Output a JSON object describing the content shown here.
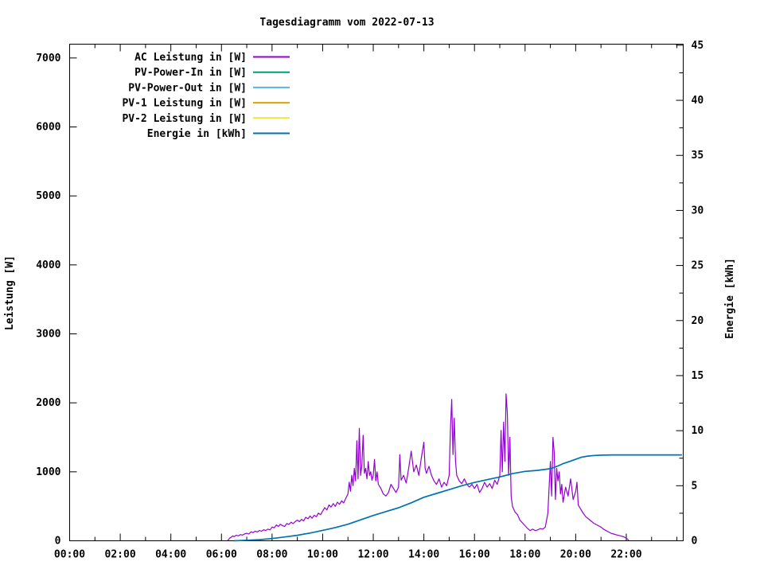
{
  "chart_data": {
    "type": "line",
    "title": "Tagesdiagramm vom 2022-07-13",
    "background": "#ffffff",
    "axis_color": "#000000",
    "grid": false,
    "legend_position": "top-left-inside",
    "x_axis": {
      "range_hours": [
        0,
        24.25
      ],
      "minor_step_hours": 1,
      "major_ticks": [
        {
          "h": 0,
          "label": "00:00"
        },
        {
          "h": 2,
          "label": "02:00"
        },
        {
          "h": 4,
          "label": "04:00"
        },
        {
          "h": 6,
          "label": "06:00"
        },
        {
          "h": 8,
          "label": "08:00"
        },
        {
          "h": 10,
          "label": "10:00"
        },
        {
          "h": 12,
          "label": "12:00"
        },
        {
          "h": 14,
          "label": "14:00"
        },
        {
          "h": 16,
          "label": "16:00"
        },
        {
          "h": 18,
          "label": "18:00"
        },
        {
          "h": 20,
          "label": "20:00"
        },
        {
          "h": 22,
          "label": "22:00"
        }
      ]
    },
    "left_axis": {
      "label": "Leistung [W]",
      "range": [
        0,
        7200
      ],
      "ticks": [
        {
          "v": 0,
          "label": "0"
        },
        {
          "v": 1000,
          "label": "1000"
        },
        {
          "v": 2000,
          "label": "2000"
        },
        {
          "v": 3000,
          "label": "3000"
        },
        {
          "v": 4000,
          "label": "4000"
        },
        {
          "v": 5000,
          "label": "5000"
        },
        {
          "v": 6000,
          "label": "6000"
        },
        {
          "v": 7000,
          "label": "7000"
        }
      ]
    },
    "right_axis": {
      "label": "Energie [kWh]",
      "range": [
        0,
        45.1
      ],
      "minor_step": 2.5,
      "ticks": [
        {
          "v": 0,
          "label": "0"
        },
        {
          "v": 5,
          "label": "5"
        },
        {
          "v": 10,
          "label": "10"
        },
        {
          "v": 15,
          "label": "15"
        },
        {
          "v": 20,
          "label": "20"
        },
        {
          "v": 25,
          "label": "25"
        },
        {
          "v": 30,
          "label": "30"
        },
        {
          "v": 35,
          "label": "35"
        },
        {
          "v": 40,
          "label": "40"
        },
        {
          "v": 45,
          "label": "45"
        }
      ]
    },
    "series": [
      {
        "key": "ac-leistung",
        "label": "AC Leistung in [W]",
        "color": "#9400d3",
        "axis": "left",
        "stroke_width": 1.2,
        "points": [
          [
            6.25,
            5
          ],
          [
            6.33,
            40
          ],
          [
            6.4,
            55
          ],
          [
            6.45,
            70
          ],
          [
            6.5,
            60
          ],
          [
            6.58,
            80
          ],
          [
            6.67,
            72
          ],
          [
            6.75,
            90
          ],
          [
            6.83,
            82
          ],
          [
            6.92,
            100
          ],
          [
            7.0,
            110
          ],
          [
            7.08,
            98
          ],
          [
            7.17,
            130
          ],
          [
            7.25,
            118
          ],
          [
            7.33,
            140
          ],
          [
            7.42,
            128
          ],
          [
            7.5,
            150
          ],
          [
            7.58,
            138
          ],
          [
            7.67,
            160
          ],
          [
            7.75,
            148
          ],
          [
            7.83,
            170
          ],
          [
            7.92,
            158
          ],
          [
            8.0,
            200
          ],
          [
            8.08,
            188
          ],
          [
            8.17,
            230
          ],
          [
            8.25,
            208
          ],
          [
            8.33,
            240
          ],
          [
            8.42,
            218
          ],
          [
            8.5,
            208
          ],
          [
            8.58,
            250
          ],
          [
            8.67,
            238
          ],
          [
            8.75,
            270
          ],
          [
            8.83,
            248
          ],
          [
            8.92,
            280
          ],
          [
            9.0,
            300
          ],
          [
            9.08,
            278
          ],
          [
            9.17,
            310
          ],
          [
            9.25,
            288
          ],
          [
            9.33,
            340
          ],
          [
            9.42,
            318
          ],
          [
            9.5,
            360
          ],
          [
            9.58,
            328
          ],
          [
            9.67,
            370
          ],
          [
            9.75,
            348
          ],
          [
            9.83,
            400
          ],
          [
            9.92,
            378
          ],
          [
            10.0,
            430
          ],
          [
            10.08,
            480
          ],
          [
            10.17,
            448
          ],
          [
            10.25,
            520
          ],
          [
            10.33,
            488
          ],
          [
            10.42,
            540
          ],
          [
            10.5,
            498
          ],
          [
            10.58,
            560
          ],
          [
            10.67,
            528
          ],
          [
            10.75,
            580
          ],
          [
            10.83,
            548
          ],
          [
            10.92,
            620
          ],
          [
            11.0,
            680
          ],
          [
            11.05,
            850
          ],
          [
            11.1,
            718
          ],
          [
            11.15,
            950
          ],
          [
            11.2,
            798
          ],
          [
            11.25,
            1050
          ],
          [
            11.3,
            868
          ],
          [
            11.35,
            1450
          ],
          [
            11.4,
            898
          ],
          [
            11.45,
            1630
          ],
          [
            11.5,
            948
          ],
          [
            11.55,
            1100
          ],
          [
            11.6,
            1530
          ],
          [
            11.65,
            978
          ],
          [
            11.7,
            1050
          ],
          [
            11.75,
            898
          ],
          [
            11.8,
            1150
          ],
          [
            11.85,
            948
          ],
          [
            11.9,
            1000
          ],
          [
            11.95,
            878
          ],
          [
            12.0,
            948
          ],
          [
            12.05,
            1180
          ],
          [
            12.1,
            868
          ],
          [
            12.15,
            1000
          ],
          [
            12.2,
            818
          ],
          [
            12.3,
            758
          ],
          [
            12.4,
            678
          ],
          [
            12.5,
            648
          ],
          [
            12.6,
            700
          ],
          [
            12.7,
            818
          ],
          [
            12.8,
            758
          ],
          [
            12.9,
            700
          ],
          [
            13.0,
            778
          ],
          [
            13.05,
            1250
          ],
          [
            13.1,
            878
          ],
          [
            13.2,
            948
          ],
          [
            13.3,
            838
          ],
          [
            13.4,
            1050
          ],
          [
            13.5,
            1300
          ],
          [
            13.6,
            1000
          ],
          [
            13.7,
            1100
          ],
          [
            13.8,
            948
          ],
          [
            13.9,
            1200
          ],
          [
            14.0,
            1430
          ],
          [
            14.05,
            1050
          ],
          [
            14.1,
            978
          ],
          [
            14.2,
            1080
          ],
          [
            14.3,
            948
          ],
          [
            14.4,
            868
          ],
          [
            14.5,
            818
          ],
          [
            14.6,
            898
          ],
          [
            14.7,
            778
          ],
          [
            14.8,
            848
          ],
          [
            14.9,
            798
          ],
          [
            15.0,
            948
          ],
          [
            15.05,
            1620
          ],
          [
            15.1,
            2050
          ],
          [
            15.15,
            1250
          ],
          [
            15.2,
            1780
          ],
          [
            15.25,
            1150
          ],
          [
            15.3,
            948
          ],
          [
            15.4,
            868
          ],
          [
            15.5,
            828
          ],
          [
            15.6,
            898
          ],
          [
            15.7,
            818
          ],
          [
            15.8,
            778
          ],
          [
            15.9,
            818
          ],
          [
            16.0,
            758
          ],
          [
            16.1,
            818
          ],
          [
            16.2,
            700
          ],
          [
            16.3,
            758
          ],
          [
            16.4,
            848
          ],
          [
            16.5,
            778
          ],
          [
            16.6,
            828
          ],
          [
            16.7,
            758
          ],
          [
            16.8,
            878
          ],
          [
            16.9,
            818
          ],
          [
            17.0,
            948
          ],
          [
            17.05,
            1600
          ],
          [
            17.1,
            1000
          ],
          [
            17.15,
            1720
          ],
          [
            17.2,
            1150
          ],
          [
            17.25,
            2130
          ],
          [
            17.3,
            1850
          ],
          [
            17.35,
            948
          ],
          [
            17.4,
            1500
          ],
          [
            17.45,
            648
          ],
          [
            17.5,
            498
          ],
          [
            17.6,
            418
          ],
          [
            17.7,
            378
          ],
          [
            17.8,
            298
          ],
          [
            17.9,
            258
          ],
          [
            18.0,
            218
          ],
          [
            18.1,
            178
          ],
          [
            18.2,
            148
          ],
          [
            18.3,
            168
          ],
          [
            18.4,
            148
          ],
          [
            18.5,
            158
          ],
          [
            18.6,
            178
          ],
          [
            18.7,
            168
          ],
          [
            18.8,
            198
          ],
          [
            18.9,
            400
          ],
          [
            19.0,
            1150
          ],
          [
            19.05,
            648
          ],
          [
            19.1,
            1500
          ],
          [
            19.15,
            1280
          ],
          [
            19.2,
            598
          ],
          [
            19.25,
            1050
          ],
          [
            19.3,
            868
          ],
          [
            19.35,
            1000
          ],
          [
            19.4,
            678
          ],
          [
            19.45,
            818
          ],
          [
            19.5,
            558
          ],
          [
            19.6,
            778
          ],
          [
            19.7,
            648
          ],
          [
            19.8,
            898
          ],
          [
            19.9,
            598
          ],
          [
            20.0,
            718
          ],
          [
            20.05,
            848
          ],
          [
            20.1,
            518
          ],
          [
            20.2,
            458
          ],
          [
            20.3,
            398
          ],
          [
            20.4,
            348
          ],
          [
            20.5,
            318
          ],
          [
            20.6,
            288
          ],
          [
            20.7,
            258
          ],
          [
            20.8,
            238
          ],
          [
            20.9,
            218
          ],
          [
            21.0,
            198
          ],
          [
            21.1,
            168
          ],
          [
            21.2,
            148
          ],
          [
            21.3,
            128
          ],
          [
            21.4,
            108
          ],
          [
            21.5,
            98
          ],
          [
            21.6,
            88
          ],
          [
            21.7,
            78
          ],
          [
            21.8,
            68
          ],
          [
            21.9,
            58
          ],
          [
            22.0,
            38
          ],
          [
            22.1,
            8
          ]
        ]
      },
      {
        "key": "pv-power-in",
        "label": "PV-Power-In in [W]",
        "color": "#009e73",
        "axis": "left",
        "stroke_width": 1.2,
        "points": []
      },
      {
        "key": "pv-power-out",
        "label": "PV-Power-Out in [W]",
        "color": "#56b4e9",
        "axis": "left",
        "stroke_width": 1.2,
        "points": []
      },
      {
        "key": "pv1-leistung",
        "label": "PV-1 Leistung in [W]",
        "color": "#e69f00",
        "axis": "left",
        "stroke_width": 1.2,
        "points": []
      },
      {
        "key": "pv2-leistung",
        "label": "PV-2 Leistung in [W]",
        "color": "#f0e442",
        "axis": "left",
        "stroke_width": 1.2,
        "points": []
      },
      {
        "key": "energie",
        "label": "Energie in [kWh]",
        "color": "#0072b2",
        "axis": "right",
        "stroke_width": 1.7,
        "points": [
          [
            6.5,
            0
          ],
          [
            7,
            0.05
          ],
          [
            7.5,
            0.1
          ],
          [
            8,
            0.2
          ],
          [
            8.5,
            0.35
          ],
          [
            9,
            0.5
          ],
          [
            9.5,
            0.7
          ],
          [
            10,
            0.95
          ],
          [
            10.5,
            1.2
          ],
          [
            11,
            1.5
          ],
          [
            11.5,
            1.9
          ],
          [
            12,
            2.3
          ],
          [
            12.5,
            2.65
          ],
          [
            13,
            3.0
          ],
          [
            13.5,
            3.45
          ],
          [
            14,
            3.95
          ],
          [
            14.5,
            4.3
          ],
          [
            15,
            4.65
          ],
          [
            15.5,
            5.0
          ],
          [
            16,
            5.3
          ],
          [
            16.5,
            5.55
          ],
          [
            17,
            5.8
          ],
          [
            17.5,
            6.1
          ],
          [
            18,
            6.3
          ],
          [
            18.5,
            6.4
          ],
          [
            19,
            6.55
          ],
          [
            19.25,
            6.75
          ],
          [
            19.5,
            7.0
          ],
          [
            19.75,
            7.2
          ],
          [
            20,
            7.4
          ],
          [
            20.25,
            7.6
          ],
          [
            20.5,
            7.7
          ],
          [
            20.75,
            7.75
          ],
          [
            21,
            7.78
          ],
          [
            21.5,
            7.8
          ],
          [
            22,
            7.8
          ],
          [
            23,
            7.8
          ],
          [
            24.2,
            7.8
          ]
        ]
      }
    ]
  }
}
